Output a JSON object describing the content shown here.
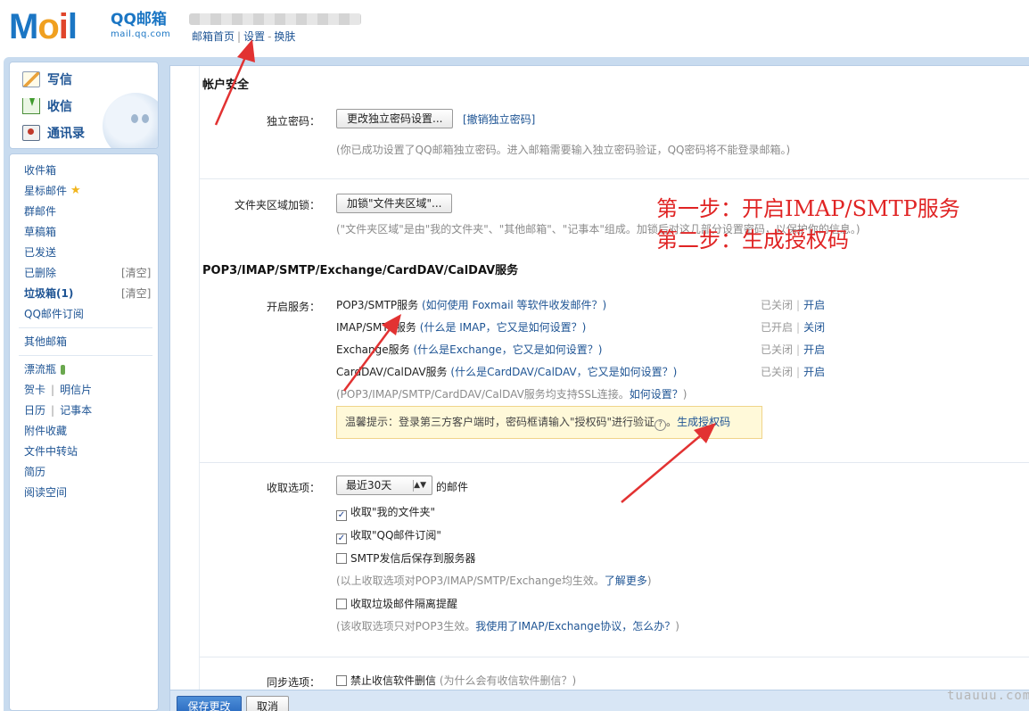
{
  "header": {
    "logo_prefix": "M",
    "logo_o": "o",
    "logo_i": "i",
    "logo_suffix": "l",
    "brand_name": "QQ邮箱",
    "brand_domain": "mail.qq.com",
    "nav": [
      "邮箱首页",
      "设置",
      "换肤"
    ],
    "nav_sep": "|",
    "nav_sep2": "-"
  },
  "sidebar": {
    "compose": "写信",
    "receive": "收信",
    "contacts": "通讯录",
    "folders": [
      "收件箱",
      "星标邮件",
      "群邮件",
      "草稿箱",
      "已发送",
      "已删除",
      "垃圾箱(1)",
      "QQ邮件订阅"
    ],
    "clear_label": "[清空]",
    "other_mailbox": "其他邮箱",
    "apps": {
      "drift_bottle": "漂流瓶",
      "greeting_card": "贺卡",
      "postcard": "明信片",
      "calendar": "日历",
      "notebook": "记事本",
      "attachments": "附件收藏",
      "file_transfer": "文件中转站",
      "resume": "简历",
      "reading_space": "阅读空间"
    }
  },
  "account_security": {
    "title": "帐户安全",
    "password_label": "独立密码：",
    "password_button": "更改独立密码设置...",
    "cancel_password_link": "[撤销独立密码]",
    "password_hint": "(你已成功设置了QQ邮箱独立密码。进入邮箱需要输入独立密码验证，QQ密码将不能登录邮箱。)",
    "folder_lock_label": "文件夹区域加锁：",
    "folder_lock_button": "加锁\"文件夹区域\"...",
    "folder_lock_hint": "(\"文件夹区域\"是由\"我的文件夹\"、\"其他邮箱\"、\"记事本\"组成。加锁后对这几部分设置密码，以保护你的信息。)"
  },
  "annotations": {
    "step1": "第一步：开启IMAP/SMTP服务",
    "step2": "第二步：生成授权码"
  },
  "services": {
    "title": "POP3/IMAP/SMTP/Exchange/CardDAV/CalDAV服务",
    "enable_label": "开启服务：",
    "rows": [
      {
        "name": "POP3/SMTP服务",
        "help": "如何使用 Foxmail 等软件收发邮件？",
        "status": "已关闭",
        "action": "开启"
      },
      {
        "name": "IMAP/SMTP服务",
        "help": "什么是 IMAP，它又是如何设置？",
        "status": "已开启",
        "action": "关闭"
      },
      {
        "name": "Exchange服务",
        "help": "什么是Exchange，它又是如何设置？",
        "status": "已关闭",
        "action": "开启"
      },
      {
        "name": "CardDAV/CalDAV服务",
        "help": "什么是CardDAV/CalDAV，它又是如何设置？",
        "status": "已关闭",
        "action": "开启"
      }
    ],
    "paren_open": "(",
    "paren_close": ")",
    "pipe": "|",
    "ssl_hint_prefix": "(POP3/IMAP/SMTP/CardDAV/CalDAV服务均支持SSL连接。",
    "ssl_hint_link": "如何设置？",
    "ssl_hint_suffix": ")",
    "tip_text": "温馨提示：登录第三方客户端时，密码框请输入\"授权码\"进行验证",
    "tip_icon": "?",
    "tip_link": "生成授权码",
    "tip_period": "。"
  },
  "receive_options": {
    "label": "收取选项：",
    "range_value": "最近30天",
    "range_suffix": "的邮件",
    "check_mark": "✓",
    "options": [
      {
        "label": "收取\"我的文件夹\"",
        "checked": true
      },
      {
        "label": "收取\"QQ邮件订阅\"",
        "checked": true
      },
      {
        "label": "SMTP发信后保存到服务器",
        "checked": false
      }
    ],
    "hint1_prefix": "(以上收取选项对POP3/IMAP/SMTP/Exchange均生效。",
    "hint1_link": "了解更多",
    "hint1_suffix": ")",
    "spam_option": "收取垃圾邮件隔离提醒",
    "hint2_prefix": "(该收取选项只对POP3生效。",
    "hint2_link": "我使用了IMAP/Exchange协议，怎么办？",
    "hint2_suffix": ")"
  },
  "sync_options": {
    "label": "同步选项：",
    "option": "禁止收信软件删信",
    "help": "为什么会有收信软件删信？"
  },
  "footer": {
    "save": "保存更改",
    "cancel": "取消"
  },
  "watermark": "tuauuu.com",
  "colors": {
    "accent": "#1e5494",
    "annotation_red": "#e02424",
    "frame_blue": "#c8dbef"
  }
}
